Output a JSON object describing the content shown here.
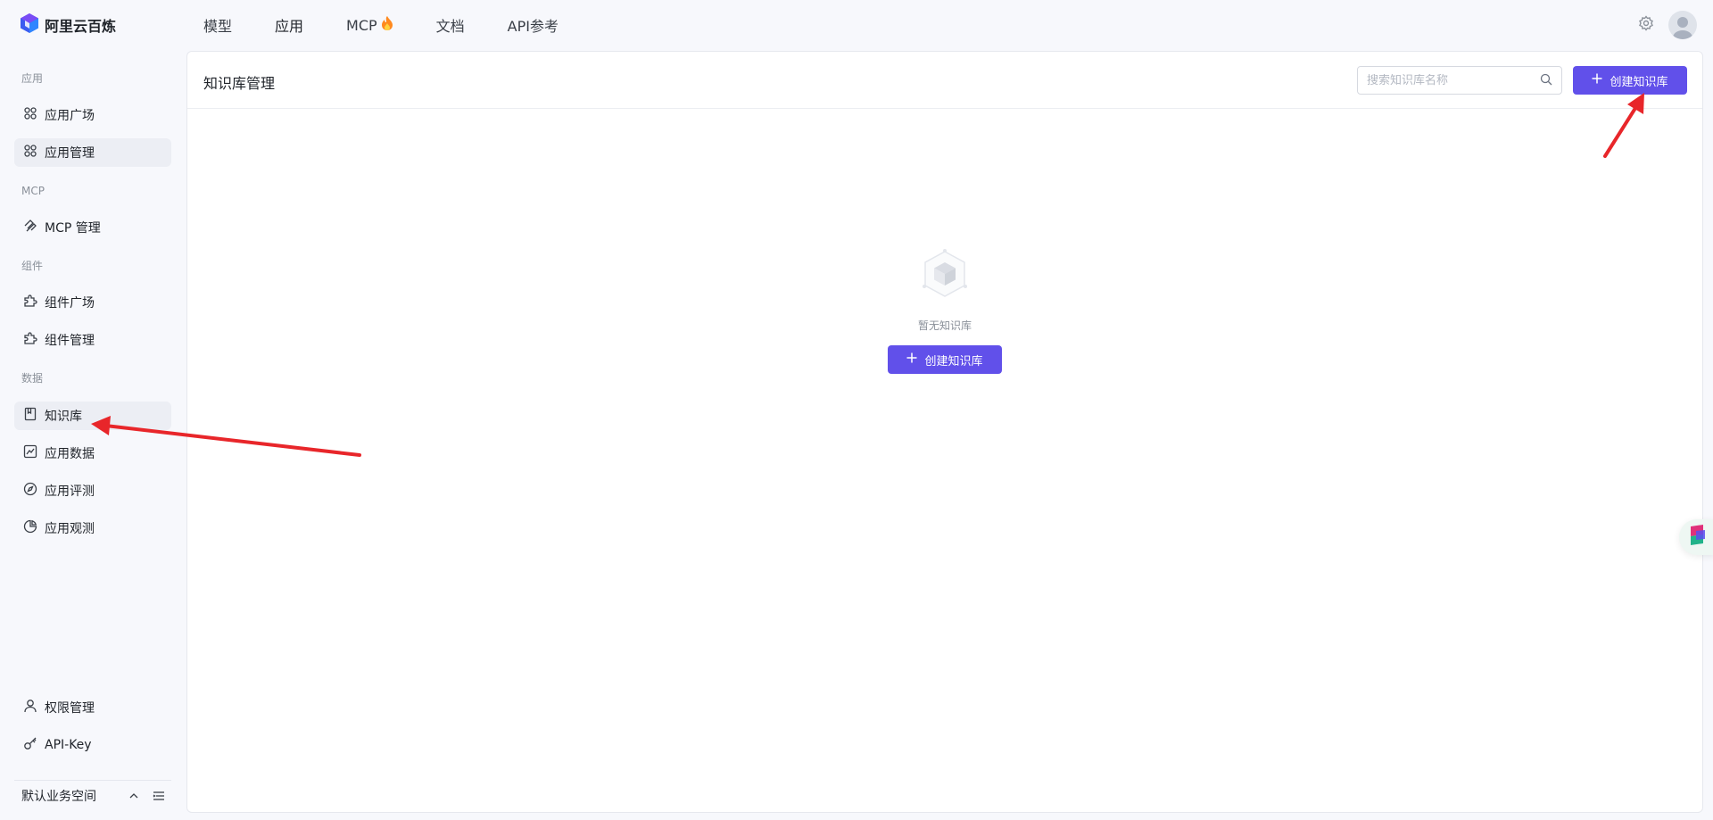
{
  "brand": {
    "name": "阿里云百炼"
  },
  "topnav": {
    "items": [
      {
        "label": "模型"
      },
      {
        "label": "应用"
      },
      {
        "label": "MCP"
      },
      {
        "label": "文档"
      },
      {
        "label": "API参考"
      }
    ]
  },
  "sidebar": {
    "sections": {
      "app": "应用",
      "mcp": "MCP",
      "component": "组件",
      "data": "数据"
    },
    "items": {
      "app_square": "应用广场",
      "app_manage": "应用管理",
      "mcp_manage": "MCP 管理",
      "comp_square": "组件广场",
      "comp_manage": "组件管理",
      "knowledge": "知识库",
      "app_data": "应用数据",
      "app_eval": "应用评测",
      "app_observe": "应用观测",
      "permission": "权限管理",
      "api_key": "API-Key"
    },
    "workspace": "默认业务空间"
  },
  "main": {
    "title": "知识库管理",
    "search_placeholder": "搜索知识库名称",
    "create_label": "创建知识库",
    "empty_text": "暂无知识库"
  },
  "colors": {
    "accent": "#6150ea",
    "annotation": "#e8262a"
  },
  "icons": [
    "logo-icon",
    "fire-icon",
    "settings-icon",
    "avatar",
    "apps-grid-icon",
    "mcp-icon",
    "puzzle-icon",
    "book-icon",
    "chart-line-icon",
    "compass-icon",
    "pie-chart-icon",
    "user-icon",
    "key-icon",
    "chevron-up-icon",
    "menu-icon",
    "search-icon",
    "plus-icon",
    "empty-box-icon"
  ]
}
